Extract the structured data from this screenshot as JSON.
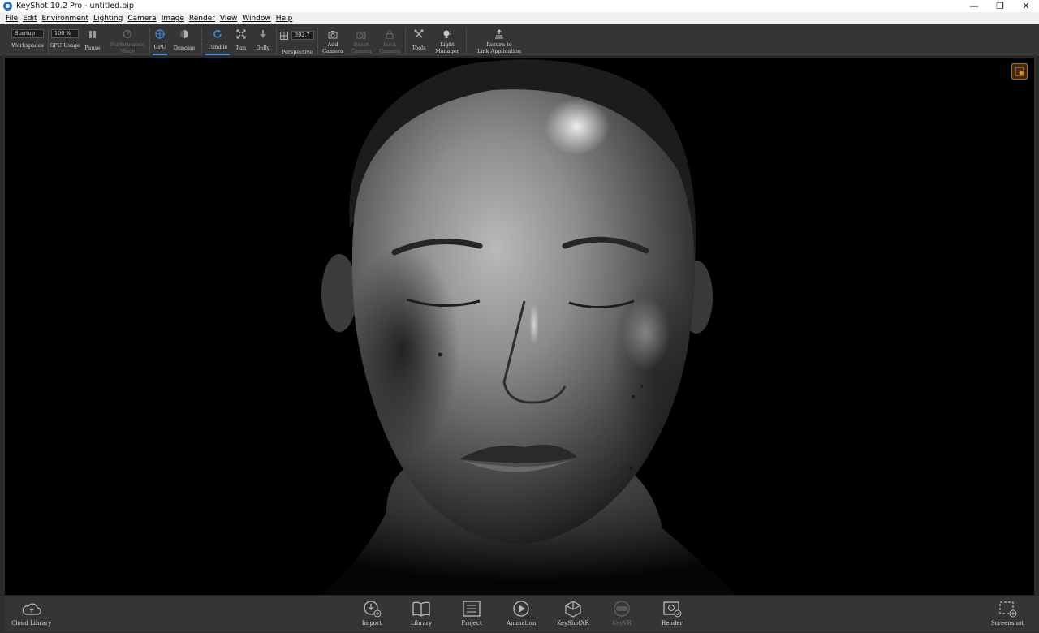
{
  "window": {
    "title": "KeyShot 10.2 Pro  - untitled.bip",
    "controls": {
      "minimize": "—",
      "maximize": "❐",
      "close": "✕"
    }
  },
  "menu": [
    "File",
    "Edit",
    "Environment",
    "Lighting",
    "Camera",
    "Image",
    "Render",
    "View",
    "Window",
    "Help"
  ],
  "toolbar": {
    "workspaces_value": "Startup",
    "workspaces_label": "Workspaces",
    "gpu_usage_value": "100 %",
    "gpu_usage_label": "GPU Usage",
    "pause_label": "Pause",
    "performance_mode_label_1": "Performance",
    "performance_mode_label_2": "Mode",
    "gpu_label": "GPU",
    "denoise_label": "Denoise",
    "tumble_label": "Tumble",
    "pan_label": "Pan",
    "dolly_label": "Dolly",
    "perspective_value": "392.7",
    "perspective_label": "Perspective",
    "add_camera_1": "Add",
    "add_camera_2": "Camera",
    "reset_camera_1": "Reset",
    "reset_camera_2": "Camera",
    "lock_camera_1": "Lock",
    "lock_camera_2": "Camera",
    "tools_label": "Tools",
    "light_manager_1": "Light",
    "light_manager_2": "Manager",
    "return_1": "Return to",
    "return_2": "Link Application"
  },
  "bottom": {
    "cloud_library": "Cloud Library",
    "import": "Import",
    "library": "Library",
    "project": "Project",
    "animation": "Animation",
    "keyshotxr": "KeyShotXR",
    "keyvr": "KeyVR",
    "render": "Render",
    "screenshot": "Screenshot"
  },
  "colors": {
    "accent": "#3d8be0",
    "toolbar_bg": "#353535",
    "viewport_bg": "#000000",
    "render_indicator": "#b26a1a"
  },
  "icons": [
    "keyshot-logo-icon",
    "pause-icon",
    "performance-mode-icon",
    "gpu-icon",
    "denoise-icon",
    "tumble-icon",
    "pan-icon",
    "dolly-icon",
    "perspective-icon",
    "add-camera-icon",
    "reset-camera-icon",
    "lock-camera-icon",
    "tools-icon",
    "light-manager-icon",
    "return-link-icon",
    "cloud-library-icon",
    "import-icon",
    "library-icon",
    "project-icon",
    "animation-icon",
    "keyshotxr-icon",
    "keyvr-icon",
    "render-icon",
    "screenshot-icon",
    "render-status-icon"
  ]
}
